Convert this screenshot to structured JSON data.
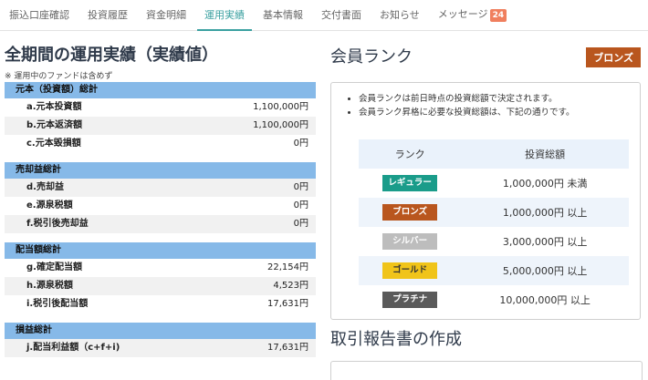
{
  "tabs": [
    {
      "label": "振込口座確認"
    },
    {
      "label": "投資履歴"
    },
    {
      "label": "資金明細"
    },
    {
      "label": "運用実績"
    },
    {
      "label": "基本情報"
    },
    {
      "label": "交付書面"
    },
    {
      "label": "お知らせ"
    },
    {
      "label": "メッセージ",
      "badge": "24"
    }
  ],
  "left": {
    "title": "全期間の運用実績（実績値）",
    "note": "※ 運用中のファンドは含めず",
    "sections": [
      {
        "head": "元本（投資額）総計",
        "rows": [
          {
            "label": "a.元本投資額",
            "value": "1,100,000円"
          },
          {
            "label": "b.元本返済額",
            "value": "1,100,000円"
          },
          {
            "label": "c.元本毀損額",
            "value": "0円"
          }
        ]
      },
      {
        "head": "売却益総計",
        "rows": [
          {
            "label": "d.売却益",
            "value": "0円"
          },
          {
            "label": "e.源泉税額",
            "value": "0円"
          },
          {
            "label": "f.税引後売却益",
            "value": "0円"
          }
        ]
      },
      {
        "head": "配当額総計",
        "rows": [
          {
            "label": "g.確定配当額",
            "value": "22,154円"
          },
          {
            "label": "h.源泉税額",
            "value": "4,523円"
          },
          {
            "label": "i.税引後配当額",
            "value": "17,631円"
          }
        ]
      },
      {
        "head": "損益総計",
        "rows": [
          {
            "label": "j.配当利益額（c+f+i)",
            "value": "17,631円"
          }
        ]
      }
    ]
  },
  "right": {
    "title": "会員ランク",
    "current_rank": "ブロンズ",
    "bullets": [
      "会員ランクは前日時点の投資総額で決定されます。",
      "会員ランク昇格に必要な投資総額は、下記の通りです。"
    ],
    "table_headers": [
      "ランク",
      "投資総額"
    ],
    "ranks": [
      {
        "name": "レギュラー",
        "amount": "1,000,000円 未満",
        "color": "#1a9c8a"
      },
      {
        "name": "ブロンズ",
        "amount": "1,000,000円 以上",
        "color": "#b9561e"
      },
      {
        "name": "シルバー",
        "amount": "3,000,000円 以上",
        "color": "#bdbdbd"
      },
      {
        "name": "ゴールド",
        "amount": "5,000,000円 以上",
        "color": "#f0c419"
      },
      {
        "name": "プラチナ",
        "amount": "10,000,000円 以上",
        "color": "#5a5a5a"
      }
    ],
    "report_title": "取引報告書の作成"
  }
}
